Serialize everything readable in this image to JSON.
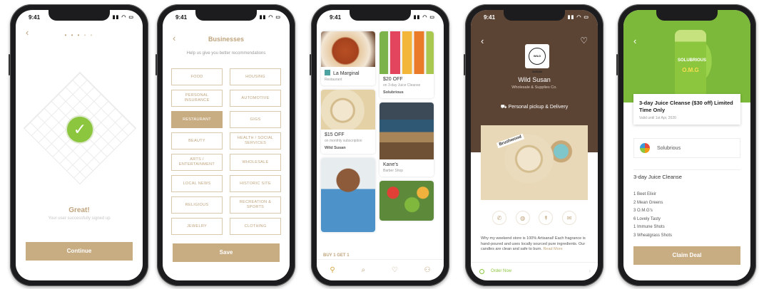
{
  "status": {
    "time": "9:41",
    "icons": "▮▮ ◠ ▭"
  },
  "screen1": {
    "back": "‹",
    "dots_on": "• • •",
    "dots_off": " • •",
    "check": "✓",
    "title": "Great!",
    "subtitle": "Your user successfully signed up",
    "button": "Continue"
  },
  "screen2": {
    "back": "‹",
    "title": "Businesses",
    "subtitle": "Help us give you better recommendations",
    "categories": [
      "FOOD",
      "HOUSING",
      "PERSONAL INSURANCE",
      "AUTOMOTIVE",
      "RESTAURANT",
      "GIGS",
      "BEAUTY",
      "HEALTH / SOCIAL SERVICES",
      "ARTS / ENTERTAINMENT",
      "WHOLESALE",
      "LOCAL NEWS",
      "HISTORIC SITE",
      "RELIGIOUS",
      "RECREATION & SPORTS",
      "JEWELRY",
      "CLOTHING"
    ],
    "selected": "RESTAURANT",
    "button": "Save"
  },
  "screen3": {
    "cards": [
      {
        "title": "La Marginal",
        "sub": "Restaurant"
      },
      {
        "title": "$15 OFF",
        "sub": "on monthly subscription",
        "biz": "Wild Susan"
      },
      {
        "title": "$20 OFF",
        "sub": "on 3-day Juice Cleanse",
        "biz": "Solubrious"
      },
      {
        "title": "Kane's",
        "sub": "Barber Shop"
      }
    ],
    "buy": "BUY 1 GET 1",
    "tabs": [
      "⚲",
      "⌕",
      "♡",
      "⚇"
    ]
  },
  "screen4": {
    "back": "‹",
    "heart": "♡",
    "logo": "WILD SUSAN",
    "name": "Wild Susan",
    "category": "Wholesale & Supplies Co.",
    "pickup": "Personal pickup & Delivery",
    "hero_label": "Brushwood",
    "actions": [
      "✆",
      "◍",
      "↟",
      "✉"
    ],
    "description": "Why my weekend store is 100% Artisanal! Each fragrance is hand-poured and uses locally sourced pure ingredients. Our candles are clean and safe to burn.",
    "more": "Read More",
    "order": "Order Now",
    "arrow": "›"
  },
  "screen5": {
    "back": "‹",
    "bottle_label": "SOLUBRIOUS",
    "bottle_name": "O.M.G",
    "deal_title": "3-day Juice Cleanse ($30 off) Limited Time Only",
    "valid": "Valid until 1st Apr, 2020",
    "merchant": "Solubrious",
    "section": "3-day Juice Cleanse",
    "items": [
      "1 Beet Elixir",
      "2 Mean Greens",
      "3 O.M.G's",
      "6 Lovely Tasty",
      "1 Immune Shots",
      "3 Wheatgrass Shots"
    ],
    "button": "Claim Deal"
  }
}
